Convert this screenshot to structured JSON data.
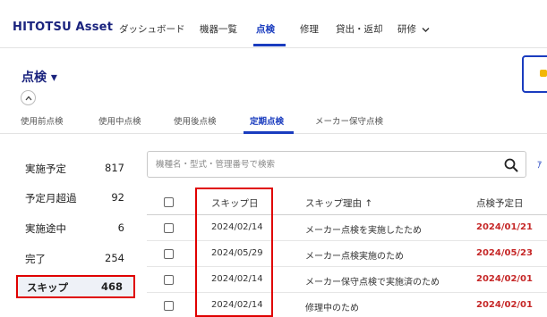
{
  "app": {
    "logo": "HITOTSU Asset"
  },
  "nav": {
    "items": [
      "ダッシュボード",
      "機器一覧",
      "点検",
      "修理",
      "貸出・返却",
      "研修"
    ],
    "active_index": 2
  },
  "page": {
    "title": "点検 ▾"
  },
  "subtabs": {
    "items": [
      "使用前点検",
      "使用中点検",
      "使用後点検",
      "定期点検",
      "メーカー保守点検"
    ],
    "active_index": 3
  },
  "status": {
    "items": [
      {
        "label": "実施予定",
        "count": "817"
      },
      {
        "label": "予定月超過",
        "count": "92"
      },
      {
        "label": "実施途中",
        "count": "6"
      },
      {
        "label": "完了",
        "count": "254"
      },
      {
        "label": "スキップ",
        "count": "468"
      }
    ],
    "selected_index": 4
  },
  "search": {
    "placeholder": "機種名・型式・管理番号で検索"
  },
  "table": {
    "headers": [
      "スキップ日",
      "スキップ理由 ↑",
      "点検予定日"
    ],
    "rows": [
      {
        "skip_date": "2024/02/14",
        "reason": "メーカー点検を実施したため",
        "planned_date": "2024/01/21"
      },
      {
        "skip_date": "2024/05/29",
        "reason": "メーカー点検実施のため",
        "planned_date": "2024/05/23"
      },
      {
        "skip_date": "2024/02/14",
        "reason": "メーカー保守点検で実施済のため",
        "planned_date": "2024/02/01"
      },
      {
        "skip_date": "2024/02/14",
        "reason": "修理中のため",
        "planned_date": "2024/02/01"
      }
    ]
  },
  "colors": {
    "brand": "#1a237e",
    "accent": "#1a3cbf",
    "highlight": "#e00000",
    "due_date": "#c62828"
  }
}
